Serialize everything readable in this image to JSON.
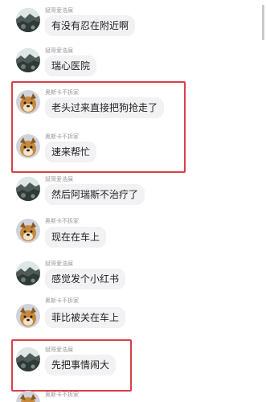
{
  "messages": [
    {
      "user": "斌哥爱浩屎",
      "text": "有没有忍在附近啊",
      "avatar": "landscape-avatar"
    },
    {
      "user": "斌哥爱浩屎",
      "text": "瑞心医院",
      "avatar": "landscape-avatar"
    },
    {
      "user": "奥斯卡不拆家",
      "text": "老头过来直接把狗抢走了",
      "avatar": "dog-avatar"
    },
    {
      "user": "奥斯卡不拆家",
      "text": "速来帮忙",
      "avatar": "dog-avatar"
    },
    {
      "user": "斌哥爱浩屎",
      "text": "然后阿瑞斯不治疗了",
      "avatar": "landscape-avatar"
    },
    {
      "user": "奥斯卡不拆家",
      "text": "现在在车上",
      "avatar": "dog-avatar"
    },
    {
      "user": "斌哥爱浩屎",
      "text": "感觉发个小红书",
      "avatar": "landscape-avatar"
    },
    {
      "user": "奥斯卡不拆家",
      "text": "菲比被关在车上",
      "avatar": "dog-avatar"
    },
    {
      "user": "斌哥爱浩屎",
      "text": "先把事情闹大",
      "avatar": "landscape-avatar"
    },
    {
      "user": "奥斯卡不拆家",
      "text": "",
      "avatar": "dog-avatar"
    }
  ],
  "colors": {
    "highlight": "#d9404a",
    "bubble": "#f2f2f4",
    "username": "#9a9a9a"
  }
}
